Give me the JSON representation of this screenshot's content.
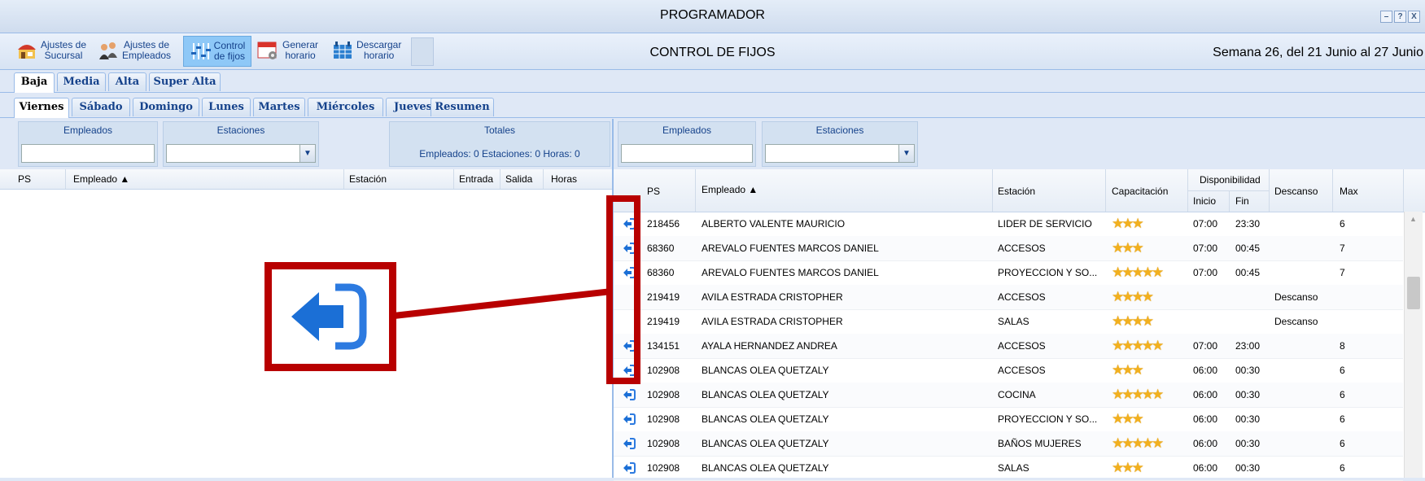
{
  "window": {
    "title": "PROGRAMADOR",
    "buttons": [
      "–",
      "?",
      "X"
    ]
  },
  "toolbar": {
    "buttons": [
      {
        "line1": "Ajustes de",
        "line2": "Sucursal",
        "icon": "store-icon"
      },
      {
        "line1": "Ajustes de",
        "line2": "Empleados",
        "icon": "employees-icon"
      },
      {
        "line1": "Control",
        "line2": "de fijos",
        "icon": "sliders-icon",
        "active": true
      },
      {
        "line1": "Generar",
        "line2": "horario",
        "icon": "calendar-gear-icon"
      },
      {
        "line1": "Descargar",
        "line2": "horario",
        "icon": "spreadsheet-icon"
      }
    ],
    "center_title": "CONTROL DE FIJOS",
    "week_label": "Semana 26, del 21 Junio al 27 Junio"
  },
  "level_tabs": [
    "Baja",
    "Media",
    "Alta",
    "Super Alta"
  ],
  "day_tabs": [
    "Viernes",
    "Sábado",
    "Domingo",
    "Lunes",
    "Martes",
    "Miércoles",
    "Jueves",
    "Resumen"
  ],
  "left_panel": {
    "filter_empleados": "Empleados",
    "filter_estaciones": "Estaciones",
    "totals_title": "Totales",
    "totals_values": "Empleados: 0   Estaciones: 0   Horas: 0",
    "columns": {
      "ps": "PS",
      "empleado": "Empleado ▲",
      "estacion": "Estación",
      "entrada": "Entrada",
      "salida": "Salida",
      "horas": "Horas"
    }
  },
  "right_panel": {
    "filter_empleados": "Empleados",
    "filter_estaciones": "Estaciones",
    "columns": {
      "ps": "PS",
      "empleado": "Empleado ▲",
      "estacion": "Estación",
      "capacitacion": "Capacitación",
      "disponibilidad": "Disponibilidad",
      "inicio": "Inicio",
      "fin": "Fin",
      "descanso": "Descanso",
      "max": "Max"
    },
    "rows": [
      {
        "arrow": true,
        "ps": "218456",
        "empleado": "ALBERTO VALENTE MAURICIO",
        "estacion": "LIDER DE SERVICIO",
        "stars": 3,
        "inicio": "07:00",
        "fin": "23:30",
        "descanso": "",
        "max": "6"
      },
      {
        "arrow": true,
        "ps": "68360",
        "empleado": "AREVALO FUENTES MARCOS DANIEL",
        "estacion": "ACCESOS",
        "stars": 3,
        "inicio": "07:00",
        "fin": "00:45",
        "descanso": "",
        "max": "7"
      },
      {
        "arrow": true,
        "ps": "68360",
        "empleado": "AREVALO FUENTES MARCOS DANIEL",
        "estacion": "PROYECCION Y SO...",
        "stars": 5,
        "inicio": "07:00",
        "fin": "00:45",
        "descanso": "",
        "max": "7"
      },
      {
        "arrow": false,
        "ps": "219419",
        "empleado": "AVILA ESTRADA CRISTOPHER",
        "estacion": "ACCESOS",
        "stars": 4,
        "inicio": "",
        "fin": "",
        "descanso": "Descanso",
        "max": ""
      },
      {
        "arrow": false,
        "ps": "219419",
        "empleado": "AVILA ESTRADA CRISTOPHER",
        "estacion": "SALAS",
        "stars": 4,
        "inicio": "",
        "fin": "",
        "descanso": "Descanso",
        "max": ""
      },
      {
        "arrow": true,
        "ps": "134151",
        "empleado": "AYALA HERNANDEZ ANDREA",
        "estacion": "ACCESOS",
        "stars": 5,
        "inicio": "07:00",
        "fin": "23:00",
        "descanso": "",
        "max": "8"
      },
      {
        "arrow": true,
        "ps": "102908",
        "empleado": "BLANCAS OLEA QUETZALY",
        "estacion": "ACCESOS",
        "stars": 3,
        "inicio": "06:00",
        "fin": "00:30",
        "descanso": "",
        "max": "6"
      },
      {
        "arrow": true,
        "ps": "102908",
        "empleado": "BLANCAS OLEA QUETZALY",
        "estacion": "COCINA",
        "stars": 5,
        "inicio": "06:00",
        "fin": "00:30",
        "descanso": "",
        "max": "6"
      },
      {
        "arrow": true,
        "ps": "102908",
        "empleado": "BLANCAS OLEA QUETZALY",
        "estacion": "PROYECCION Y SO...",
        "stars": 3,
        "inicio": "06:00",
        "fin": "00:30",
        "descanso": "",
        "max": "6"
      },
      {
        "arrow": true,
        "ps": "102908",
        "empleado": "BLANCAS OLEA QUETZALY",
        "estacion": "BAÑOS MUJERES",
        "stars": 5,
        "inicio": "06:00",
        "fin": "00:30",
        "descanso": "",
        "max": "6"
      },
      {
        "arrow": true,
        "ps": "102908",
        "empleado": "BLANCAS OLEA QUETZALY",
        "estacion": "SALAS",
        "stars": 3,
        "inicio": "06:00",
        "fin": "00:30",
        "descanso": "",
        "max": "6"
      }
    ]
  },
  "colors": {
    "accent": "#15428b",
    "highlight": "#b80000",
    "arrow": "#1b6fd6",
    "star": "#f2b01e"
  }
}
